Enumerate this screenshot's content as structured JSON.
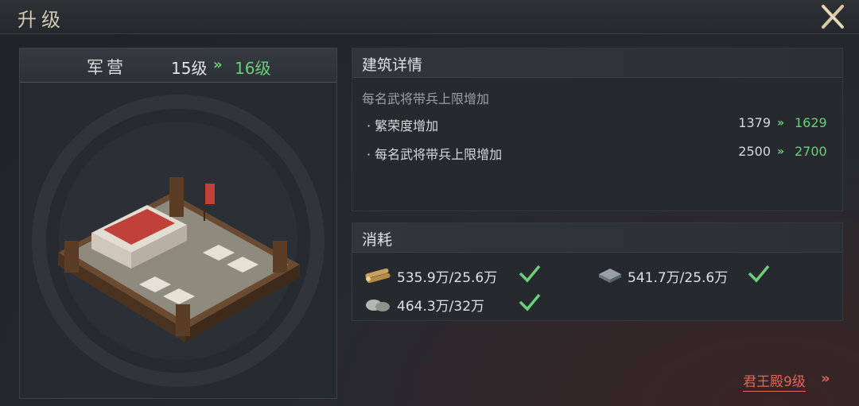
{
  "window": {
    "title": "升级"
  },
  "building": {
    "name": "军营",
    "level_from": "15级",
    "level_to": "16级",
    "arrow": "»"
  },
  "details": {
    "header": "建筑详情",
    "description": "每名武将带兵上限增加",
    "rows": [
      {
        "label": "· 繁荣度增加",
        "from": "1379",
        "to": "1629"
      },
      {
        "label": "· 每名武将带兵上限增加",
        "from": "2500",
        "to": "2700"
      }
    ]
  },
  "cost": {
    "header": "消耗",
    "items": [
      {
        "icon": "wood-icon",
        "text": "535.9万/25.6万",
        "satisfied": true
      },
      {
        "icon": "iron-icon",
        "text": "541.7万/25.6万",
        "satisfied": true
      },
      {
        "icon": "stone-icon",
        "text": "464.3万/32万",
        "satisfied": true
      }
    ]
  },
  "requirement": {
    "text": "君王殿9级",
    "arrow": "»"
  },
  "colors": {
    "green": "#6bcf7a",
    "red_link": "#e0655a"
  }
}
